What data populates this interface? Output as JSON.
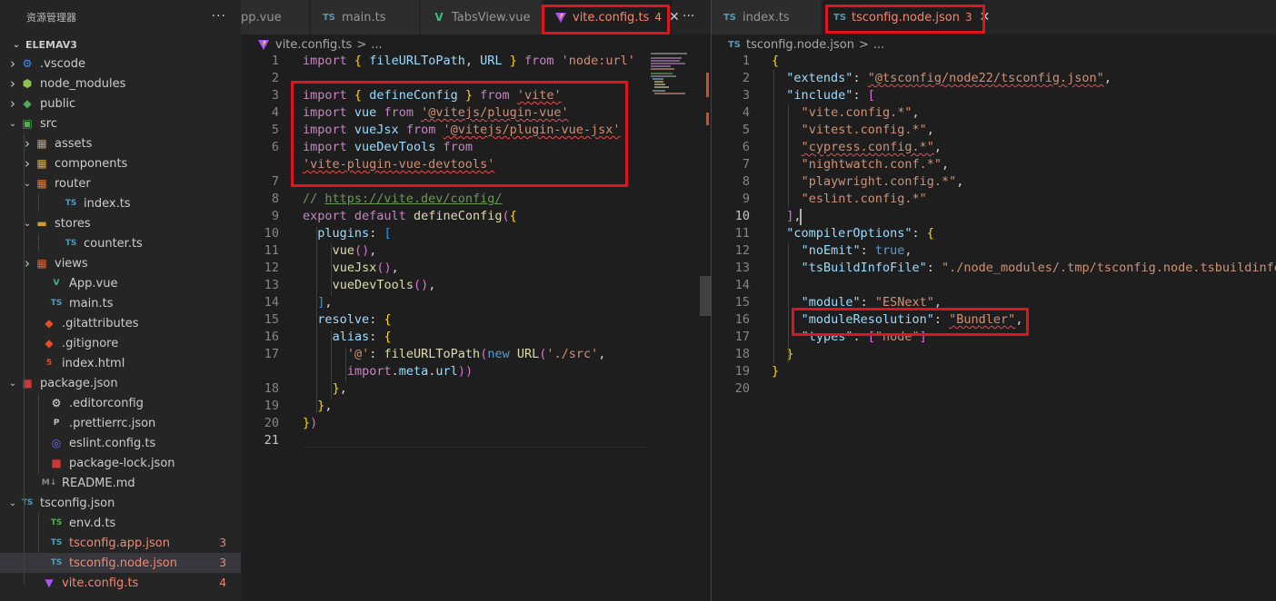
{
  "sidebar": {
    "title": "资源管理器",
    "more": "···",
    "project": "ELEMAV3",
    "items": [
      {
        "label": ".vscode",
        "icon": "vscode-folder-icon"
      },
      {
        "label": "node_modules",
        "icon": "node-folder-icon"
      },
      {
        "label": "public",
        "icon": "public-folder-icon"
      },
      {
        "label": "src",
        "icon": "src-folder-icon"
      },
      {
        "label": "assets",
        "icon": "assets-folder-icon"
      },
      {
        "label": "components",
        "icon": "components-folder-icon"
      },
      {
        "label": "router",
        "icon": "router-folder-icon"
      },
      {
        "label": "index.ts",
        "icon": "ts-file-icon"
      },
      {
        "label": "stores",
        "icon": "stores-folder-icon"
      },
      {
        "label": "counter.ts",
        "icon": "ts-file-icon"
      },
      {
        "label": "views",
        "icon": "views-folder-icon"
      },
      {
        "label": "App.vue",
        "icon": "vue-file-icon"
      },
      {
        "label": "main.ts",
        "icon": "ts-file-icon"
      },
      {
        "label": ".gitattributes",
        "icon": "git-file-icon"
      },
      {
        "label": ".gitignore",
        "icon": "git-file-icon"
      },
      {
        "label": "index.html",
        "icon": "html-file-icon"
      },
      {
        "label": "package.json",
        "icon": "npm-file-icon"
      },
      {
        "label": ".editorconfig",
        "icon": "editorconfig-file-icon"
      },
      {
        "label": ".prettierrc.json",
        "icon": "prettier-file-icon"
      },
      {
        "label": "eslint.config.ts",
        "icon": "eslint-file-icon"
      },
      {
        "label": "package-lock.json",
        "icon": "npm-file-icon"
      },
      {
        "label": "README.md",
        "icon": "markdown-file-icon"
      },
      {
        "label": "tsconfig.json",
        "icon": "tsconfig-file-icon"
      },
      {
        "label": "env.d.ts",
        "icon": "ts-file-icon"
      },
      {
        "label": "tsconfig.app.json",
        "icon": "tsconfig-file-icon",
        "badge": "3"
      },
      {
        "label": "tsconfig.node.json",
        "icon": "tsconfig-file-icon",
        "badge": "3"
      },
      {
        "label": "vite.config.ts",
        "icon": "vite-file-icon",
        "badge": "4"
      }
    ]
  },
  "left_editor": {
    "tabs": [
      {
        "label": "pp.vue"
      },
      {
        "label": "main.ts"
      },
      {
        "label": "TabsView.vue"
      },
      {
        "label": "vite.config.ts",
        "count": "4",
        "close": "✕"
      }
    ],
    "more": "···",
    "breadcrumb": {
      "file": "vite.config.ts",
      "sep": ">",
      "rest": "..."
    },
    "line_numbers": [
      "1",
      "2",
      "3",
      "4",
      "5",
      "6",
      "7",
      "8",
      "9",
      "10",
      "11",
      "12",
      "13",
      "14",
      "15",
      "16",
      "17",
      "18",
      "19",
      "20",
      "21"
    ],
    "code": [
      "import { fileURLToPath, URL } from 'node:url'",
      "",
      "import { defineConfig } from 'vite'",
      "import vue from '@vitejs/plugin-vue'",
      "import vueJsx from '@vitejs/plugin-vue-jsx'",
      "import vueDevTools from",
      "'vite-plugin-vue-devtools'",
      "",
      "// https://vite.dev/config/",
      "export default defineConfig({",
      "  plugins: [",
      "    vue(),",
      "    vueJsx(),",
      "    vueDevTools(),",
      "  ],",
      "  resolve: {",
      "    alias: {",
      "      '@': fileURLToPath(new URL('./src',",
      "      import.meta.url))",
      "    },",
      "  },",
      "})",
      ""
    ]
  },
  "right_editor": {
    "tabs": [
      {
        "label": "index.ts"
      },
      {
        "label": "tsconfig.node.json",
        "count": "3",
        "close": "✕"
      }
    ],
    "breadcrumb": {
      "file": "tsconfig.node.json",
      "sep": ">",
      "rest": "..."
    },
    "line_numbers": [
      "1",
      "2",
      "3",
      "4",
      "5",
      "6",
      "7",
      "8",
      "9",
      "10",
      "11",
      "12",
      "13",
      "14",
      "15",
      "16",
      "17",
      "18",
      "19",
      "20"
    ],
    "code": [
      "{",
      "  \"extends\": \"@tsconfig/node22/tsconfig.json\",",
      "  \"include\": [",
      "    \"vite.config.*\",",
      "    \"vitest.config.*\",",
      "    \"cypress.config.*\",",
      "    \"nightwatch.conf.*\",",
      "    \"playwright.config.*\",",
      "    \"eslint.config.*\"",
      "  ],",
      "  \"compilerOptions\": {",
      "    \"noEmit\": true,",
      "    \"tsBuildInfoFile\": \"./node_modules/.tmp/tsconfig.node.tsbuildinfo\",",
      "",
      "    \"module\": \"ESNext\",",
      "    \"moduleResolution\": \"Bundler\",",
      "    \"types\": [\"node\"]",
      "  }",
      "}",
      ""
    ]
  },
  "colors": {
    "highlight_box": "#e0141e",
    "error": "#f48771",
    "keyword": "#c586c0",
    "string": "#ce9178",
    "property": "#9cdcfe"
  }
}
